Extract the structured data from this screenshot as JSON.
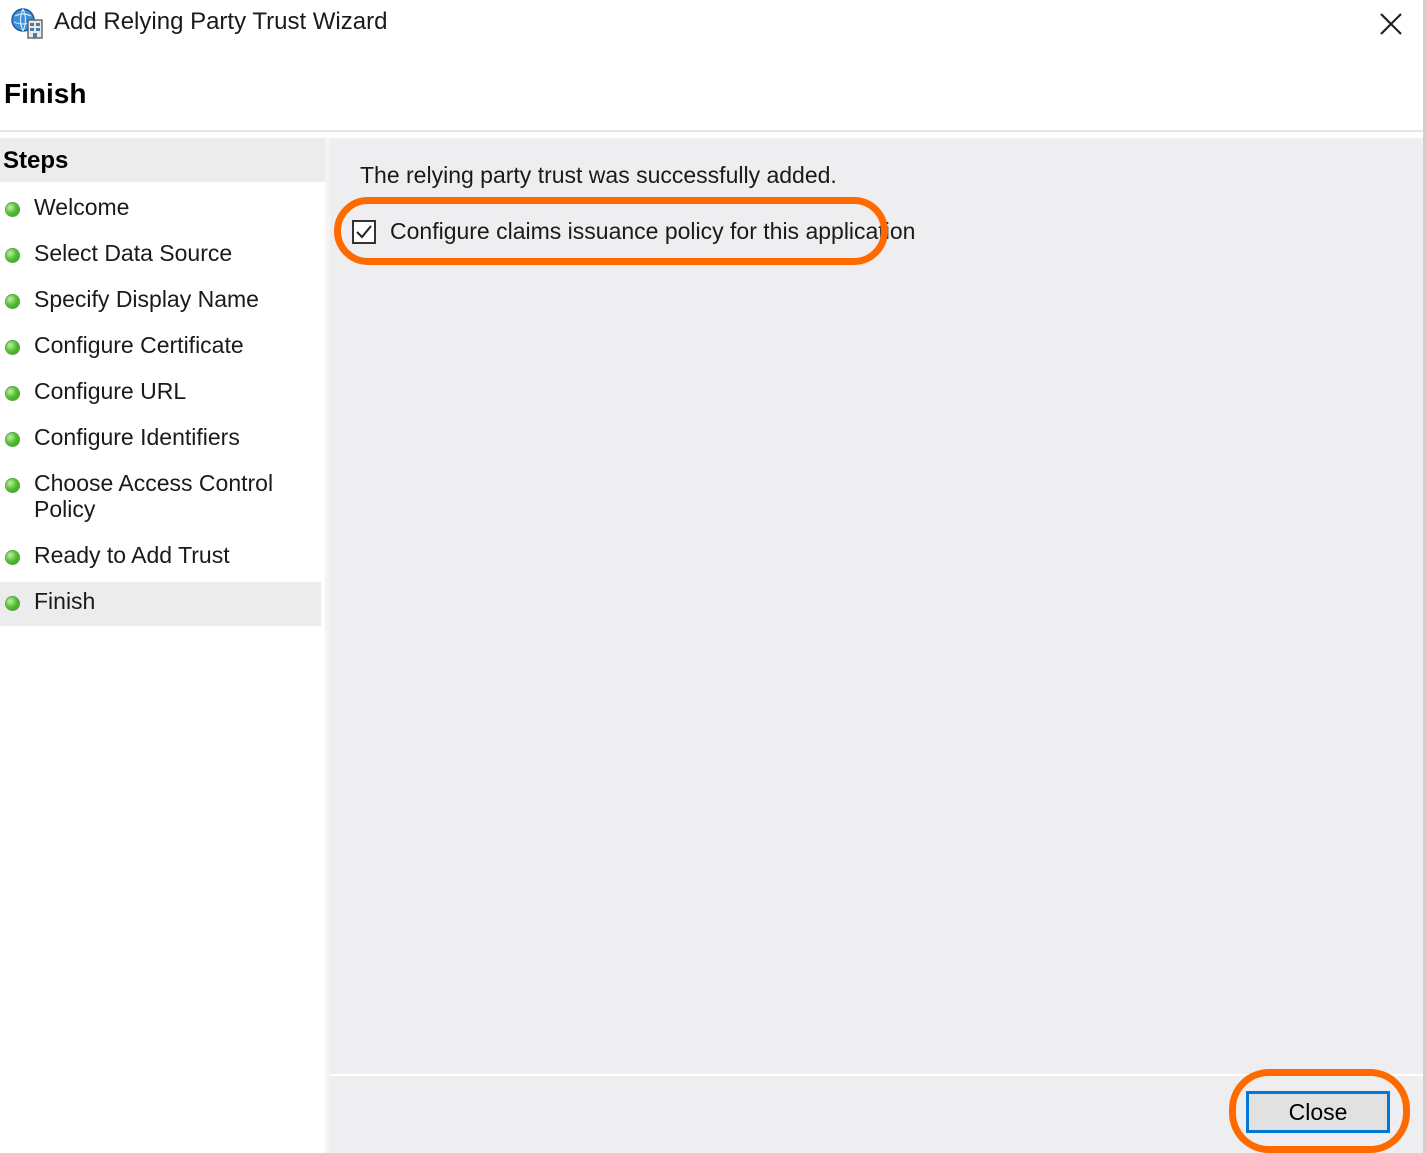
{
  "window": {
    "title": "Add Relying Party Trust Wizard",
    "title_icon": "relying-party-trust-icon",
    "close_icon": "close-icon"
  },
  "header": {
    "page_title": "Finish"
  },
  "steps": {
    "heading": "Steps",
    "items": [
      {
        "label": "Welcome",
        "status": "complete"
      },
      {
        "label": "Select Data Source",
        "status": "complete"
      },
      {
        "label": "Specify Display Name",
        "status": "complete"
      },
      {
        "label": "Configure Certificate",
        "status": "complete"
      },
      {
        "label": "Configure URL",
        "status": "complete"
      },
      {
        "label": "Configure Identifiers",
        "status": "complete"
      },
      {
        "label": "Choose Access Control Policy",
        "status": "complete"
      },
      {
        "label": "Ready to Add Trust",
        "status": "complete"
      },
      {
        "label": "Finish",
        "status": "current"
      }
    ]
  },
  "content": {
    "status_message": "The relying party trust was successfully added.",
    "checkbox_label": "Configure claims issuance policy for this application",
    "checkbox_checked": true
  },
  "footer": {
    "close_label": "Close"
  },
  "colors": {
    "highlight": "#ff6a00",
    "step_dot": "#4fbf2e",
    "button_focus_border": "#0078d7",
    "content_background": "#eeeef0"
  }
}
